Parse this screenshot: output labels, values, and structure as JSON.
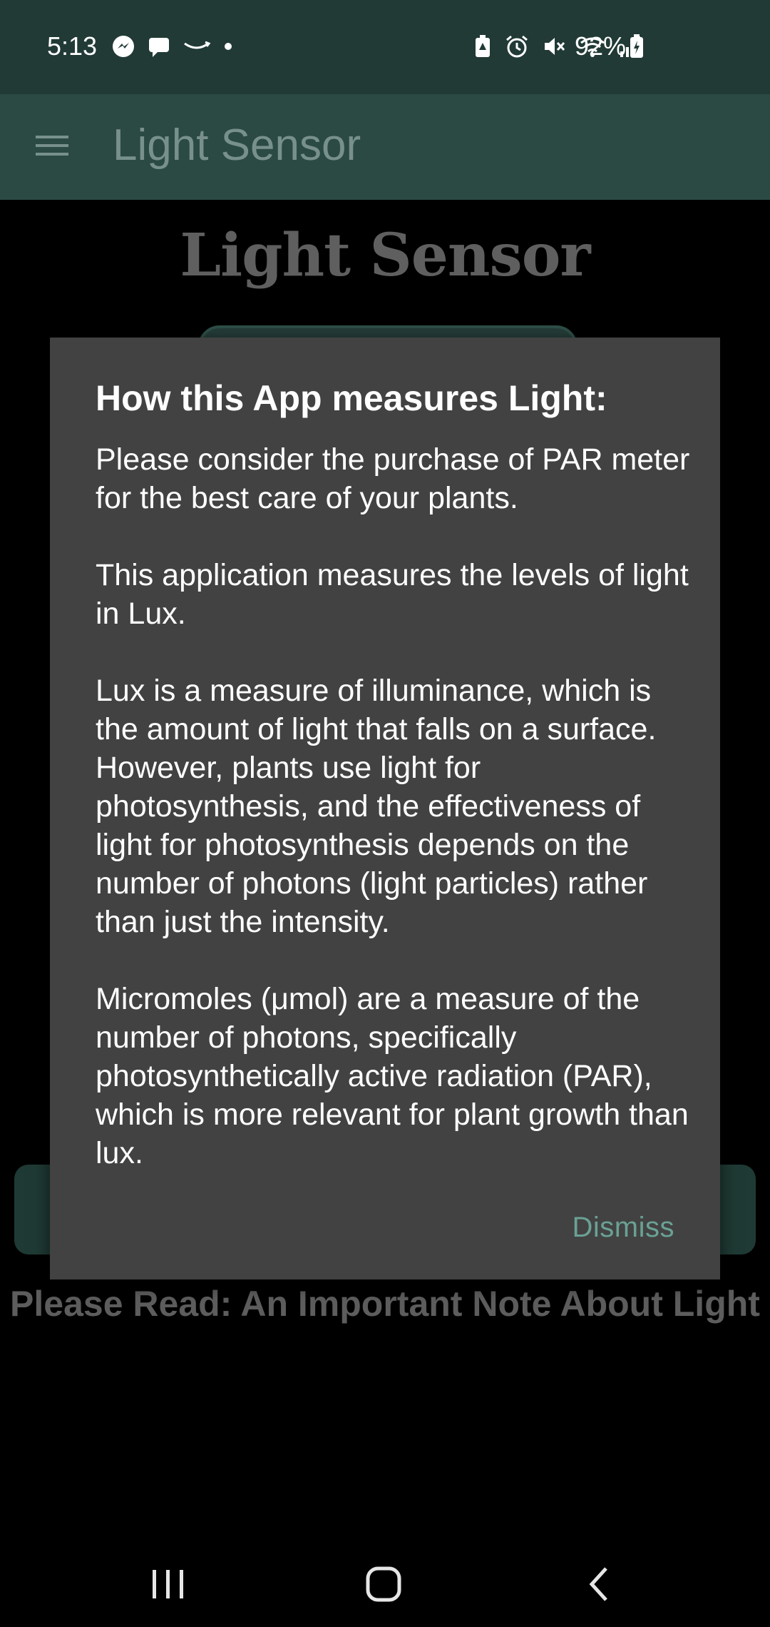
{
  "status_bar": {
    "time": "5:13",
    "notification_icons": [
      "messenger-icon",
      "chat-icon",
      "amazon-icon",
      "dot-icon"
    ],
    "system_icons": [
      "battery-saver-icon",
      "alarm-icon",
      "mute-icon",
      "wifi-icon",
      "signal-icon"
    ],
    "battery": "92%"
  },
  "app_bar": {
    "title": "Light Sensor",
    "menu_icon": "hamburger-menu-icon"
  },
  "background": {
    "heading": "Light Sensor",
    "note": "Please Read: An Important Note About Light"
  },
  "dialog": {
    "title": "How this App measures Light:",
    "paragraphs": [
      "Please consider the purchase of PAR meter for the best care of your plants.",
      "This application measures the levels of light in Lux.",
      "Lux is a measure of illuminance, which is the amount of light that falls on a surface. However, plants use light for photosynthesis, and the effectiveness of light for photosynthesis depends on the number of photons (light particles) rather than just the intensity.",
      "Micromoles (μmol) are a measure of the number of photons, specifically photosynthetically active radiation (PAR), which is more relevant for plant growth than lux."
    ],
    "dismiss_label": "Dismiss"
  },
  "nav_bar": {
    "recents": "recents-icon",
    "home": "home-icon",
    "back": "back-icon"
  },
  "colors": {
    "status_bar": "#213a35",
    "app_bar": "#2b4a44",
    "dialog": "#424242",
    "accent": "#6aa194"
  }
}
